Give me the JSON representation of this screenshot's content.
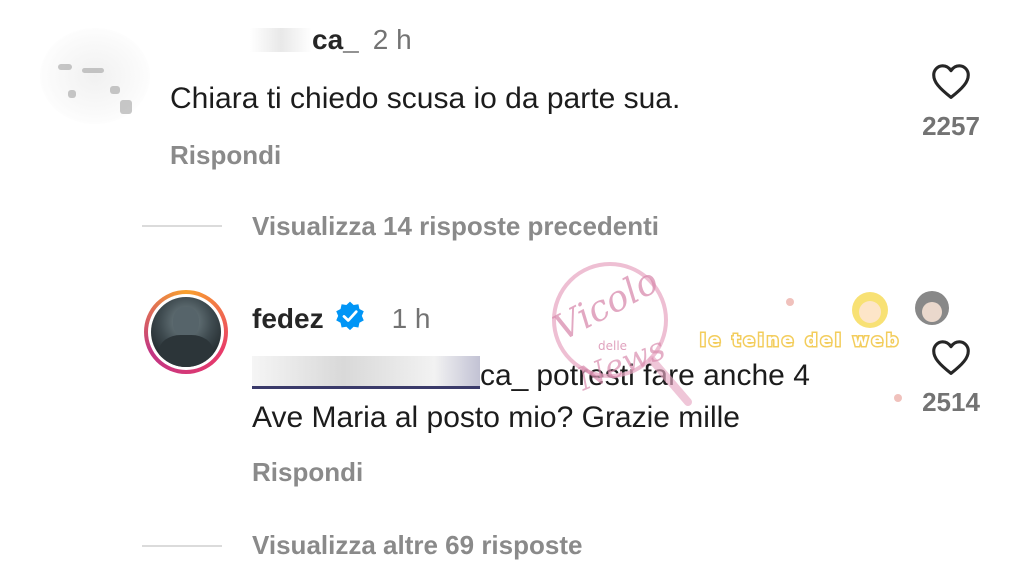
{
  "comment1": {
    "username_suffix": "ca_",
    "time": "2 h",
    "text": "Chiara ti chiedo scusa io da parte sua.",
    "reply_label": "Rispondi",
    "like_count": "2257"
  },
  "view_previous": {
    "label": "Visualizza 14 risposte precedenti"
  },
  "comment2": {
    "username": "fedez",
    "time": "1 h",
    "mention_suffix": "ca_",
    "text_line1": "potresti fare anche 4",
    "text_line2": "Ave Maria al posto mio? Grazie mille",
    "reply_label": "Rispondi",
    "like_count": "2514"
  },
  "view_more": {
    "label": "Visualizza altre 69 risposte"
  },
  "watermark": {
    "line1": "Vicolo",
    "line2": "delle",
    "line3": "News",
    "banner": "le teine del web"
  },
  "colors": {
    "verified_badge": "#0095f6",
    "secondary_text": "#737373",
    "reply_text": "#8a8a8a",
    "thread_line": "#dbdbdb"
  },
  "icons": [
    "heart-icon",
    "verified-badge-icon"
  ]
}
